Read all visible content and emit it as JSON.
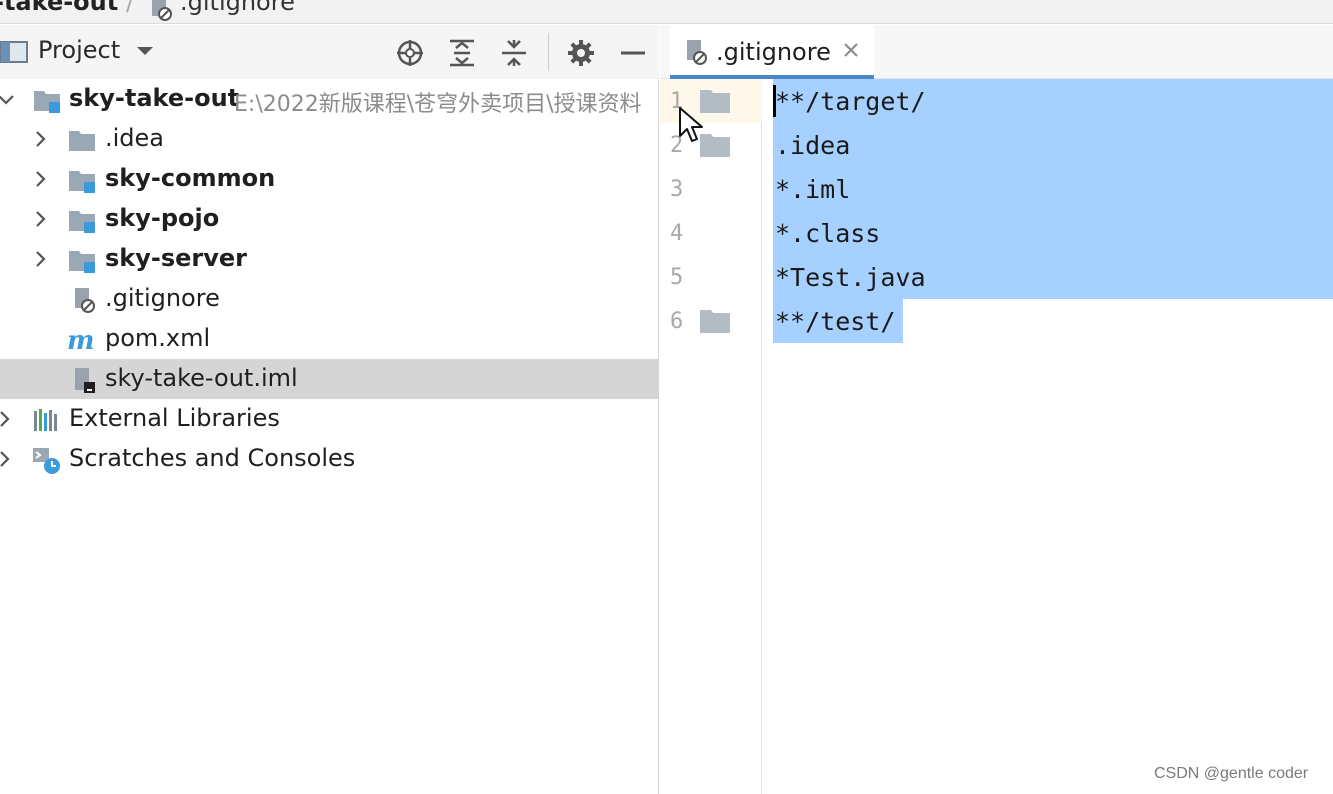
{
  "breadcrumb": {
    "project": "-take-out",
    "separator": "/",
    "file": ".gitignore"
  },
  "project_panel": {
    "title": "Project",
    "toolbar_icons": [
      "locate-icon",
      "expand-all-icon",
      "collapse-all-icon",
      "gear-icon",
      "minimize-icon"
    ]
  },
  "tree": {
    "root": {
      "label": "sky-take-out",
      "path": "E:\\2022新版课程\\苍穹外卖项目\\授课资料"
    },
    "items": [
      {
        "label": ".idea"
      },
      {
        "label": "sky-common"
      },
      {
        "label": "sky-pojo"
      },
      {
        "label": "sky-server"
      },
      {
        "label": ".gitignore"
      },
      {
        "label": "pom.xml"
      },
      {
        "label": "sky-take-out.iml"
      },
      {
        "label": "External Libraries"
      },
      {
        "label": "Scratches and Consoles"
      }
    ],
    "selected": "sky-take-out.iml"
  },
  "editor": {
    "tab_label": ".gitignore",
    "line_numbers": [
      "1",
      "2",
      "3",
      "4",
      "5",
      "6"
    ],
    "lines": [
      "**/target/",
      ".idea",
      "*.iml",
      "*.class",
      "*Test.java",
      "**/test/"
    ],
    "selection_color": "#a6d0ff"
  },
  "watermark": "CSDN @gentle coder"
}
